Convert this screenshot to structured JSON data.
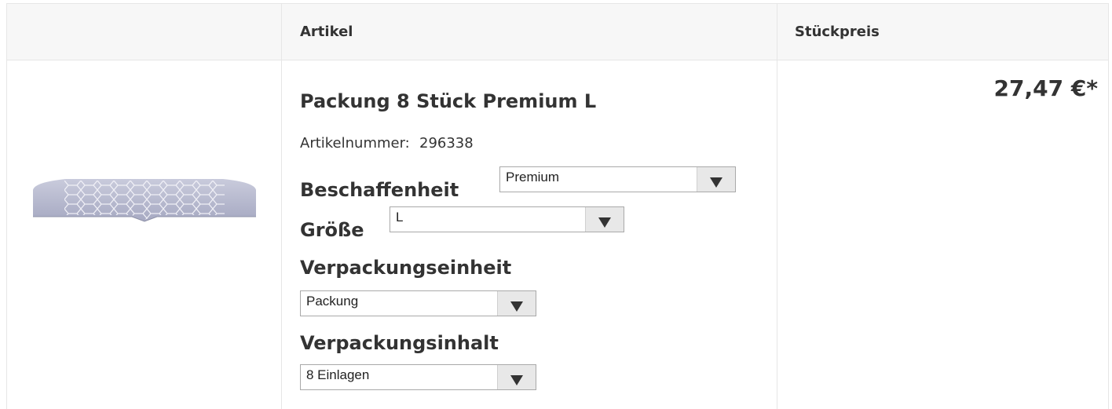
{
  "table": {
    "headers": {
      "article": "Artikel",
      "unit_price": "Stückpreis"
    }
  },
  "product": {
    "title": "Packung 8 Stück Premium L",
    "sku_label": "Artikelnummer:",
    "sku": "296338",
    "image_icon": "insole-product-image",
    "price": "27,47 €*",
    "options": {
      "beschaffenheit": {
        "label": "Beschaffenheit",
        "selected": "Premium"
      },
      "groesse": {
        "label": "Größe",
        "selected": "L"
      },
      "verpackungseinheit": {
        "label": "Verpackungseinheit",
        "selected": "Packung"
      },
      "verpackungsinhalt": {
        "label": "Verpackungsinhalt",
        "selected": "8 Einlagen"
      }
    }
  },
  "colors": {
    "header_bg": "#f7f7f7",
    "border": "#e6e6e6",
    "text": "#333333",
    "select_arrow_bg": "#e8e8e8"
  }
}
